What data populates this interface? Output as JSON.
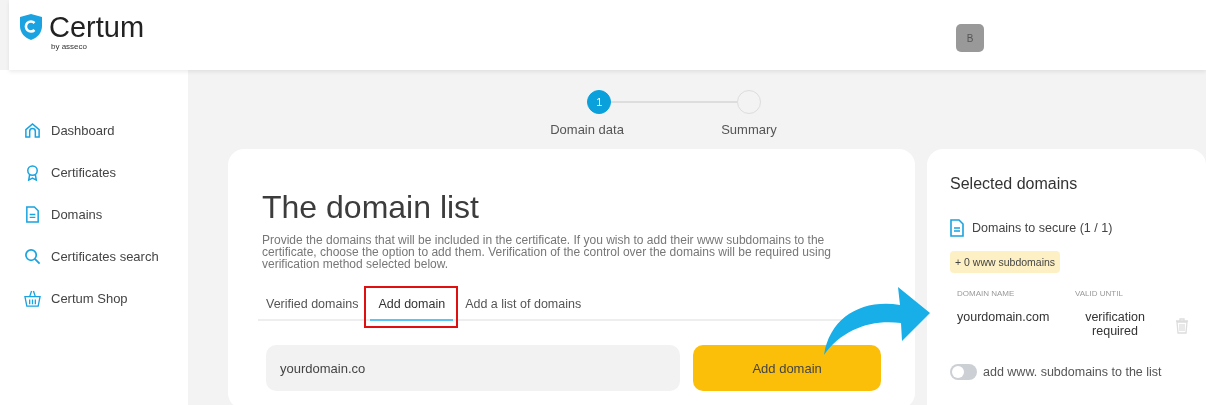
{
  "header": {
    "logo": {
      "name": "Certum",
      "tagline": "by asseco"
    },
    "avatar": "B"
  },
  "sidebar": {
    "items": [
      {
        "label": "Dashboard"
      },
      {
        "label": "Certificates"
      },
      {
        "label": "Domains"
      },
      {
        "label": "Certificates search"
      },
      {
        "label": "Certum Shop"
      }
    ]
  },
  "stepper": [
    {
      "number": "1",
      "label": "Domain data",
      "active": true
    },
    {
      "label": "Summary",
      "active": false
    }
  ],
  "main": {
    "title": "The domain list",
    "description": "Provide the domains that will be included in the certificate. If you wish to add their www subdomains to the certificate, choose the option to add them. Verification of the control over the domains will be required using verification method selected below.",
    "tabs": [
      {
        "label": "Verified domains",
        "selected": false,
        "highlighted": false
      },
      {
        "label": "Add domain",
        "selected": true,
        "highlighted": true
      },
      {
        "label": "Add a list of domains",
        "selected": false,
        "highlighted": false
      }
    ],
    "domain_field": {
      "value": "yourdomain.co"
    },
    "add_button": "Add domain"
  },
  "selected_panel": {
    "title": "Selected domains",
    "subtitle": "Domains to secure (1 / 1)",
    "badge": "+ 0 www subdomains",
    "columns": [
      "DOMAIN NAME",
      "VALID UNTIL"
    ],
    "rows": [
      {
        "domain": "yourdomain.com",
        "valid_until": "verification required"
      }
    ],
    "toggle": {
      "label": "add www. subdomains to the list",
      "on": false
    }
  }
}
